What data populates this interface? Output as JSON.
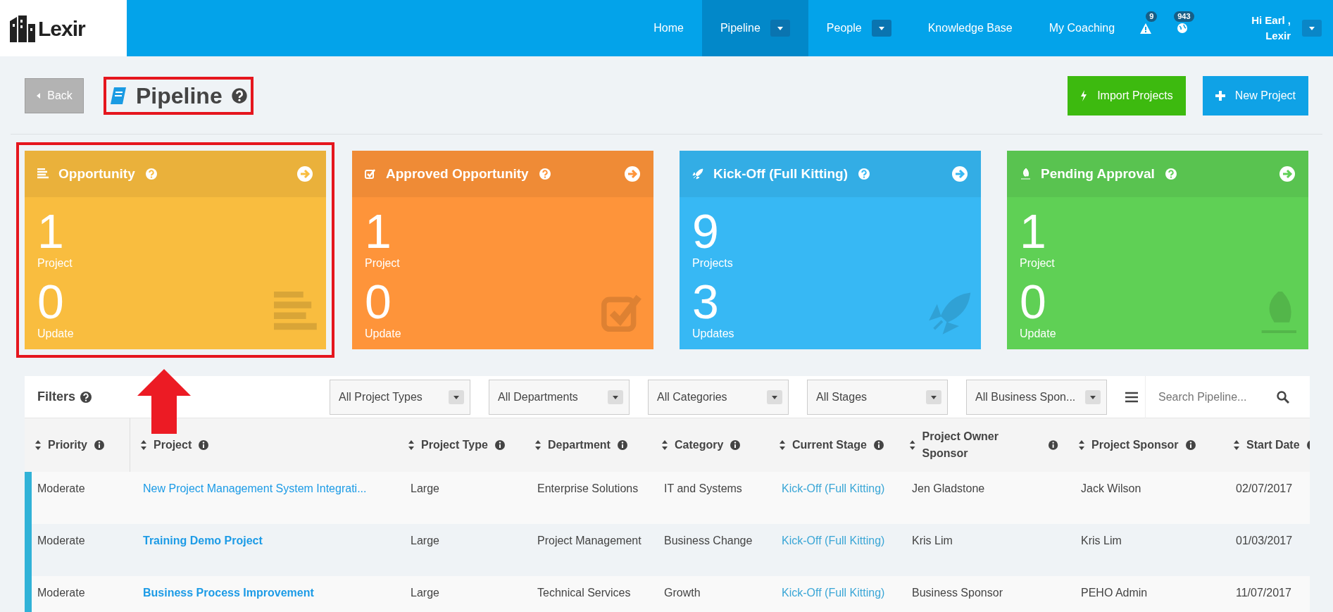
{
  "logo": {
    "text": "Lexir"
  },
  "nav": [
    {
      "label": "Home",
      "selected": false,
      "dropdown": false
    },
    {
      "label": "Pipeline",
      "selected": true,
      "dropdown": true
    },
    {
      "label": "People",
      "selected": false,
      "dropdown": true
    },
    {
      "label": "Knowledge Base",
      "selected": false,
      "dropdown": false
    },
    {
      "label": "My Coaching",
      "selected": false,
      "dropdown": false
    }
  ],
  "alerts": {
    "count": "9"
  },
  "notifications": {
    "count": "943"
  },
  "user": {
    "greeting": "Hi Earl ,",
    "name": "Lexir"
  },
  "header": {
    "back": "Back",
    "title": "Pipeline",
    "buttons": [
      {
        "label": "Import Projects",
        "color": "#3dba0f"
      },
      {
        "label": "New Project",
        "color": "#0fa2e6"
      }
    ]
  },
  "stages": [
    {
      "title": "Opportunity",
      "count": "1",
      "count_label": "Project",
      "updates": "0",
      "updates_label": "Update",
      "color": "#f9bd3f",
      "highlighted": true
    },
    {
      "title": "Approved Opportunity",
      "count": "1",
      "count_label": "Project",
      "updates": "0",
      "updates_label": "Update",
      "color": "#fe943a",
      "highlighted": false
    },
    {
      "title": "Kick-Off (Full Kitting)",
      "count": "9",
      "count_label": "Projects",
      "updates": "3",
      "updates_label": "Updates",
      "color": "#37b8f4",
      "highlighted": false
    },
    {
      "title": "Pending Approval",
      "count": "1",
      "count_label": "Project",
      "updates": "0",
      "updates_label": "Update",
      "color": "#5fd055",
      "highlighted": false
    }
  ],
  "filters": {
    "label": "Filters",
    "selects": [
      "All Project Types",
      "All Departments",
      "All Categories",
      "All Stages",
      "All Business Spon..."
    ],
    "search": {
      "placeholder": "Search Pipeline..."
    }
  },
  "table": {
    "columns": [
      "Priority",
      "Project",
      "Project Type",
      "Department",
      "Category",
      "Current Stage",
      "Project Owner Sponsor",
      "Project Sponsor",
      "Start Date"
    ],
    "rows": [
      {
        "priority": "Moderate",
        "project": "New Project Management System Integrati...",
        "project_bold": false,
        "project_type": "Large",
        "department": "Enterprise Solutions",
        "category": "IT and Systems",
        "stage": "Kick-Off (Full Kitting)",
        "owner_sponsor": "Jen Gladstone",
        "sponsor": "Jack Wilson",
        "start_date": "02/07/2017"
      },
      {
        "priority": "Moderate",
        "project": "Training Demo Project",
        "project_bold": true,
        "project_type": "Large",
        "department": "Project Management",
        "category": "Business Change",
        "stage": "Kick-Off (Full Kitting)",
        "owner_sponsor": "Kris Lim",
        "sponsor": "Kris Lim",
        "start_date": "01/03/2017"
      },
      {
        "priority": "Moderate",
        "project": "Business Process Improvement",
        "project_bold": true,
        "project_type": "Large",
        "department": "Technical Services",
        "category": "Growth",
        "stage": "Kick-Off (Full Kitting)",
        "owner_sponsor": "Business Sponsor",
        "sponsor": "PEHO Admin",
        "start_date": "11/07/2017"
      }
    ]
  }
}
